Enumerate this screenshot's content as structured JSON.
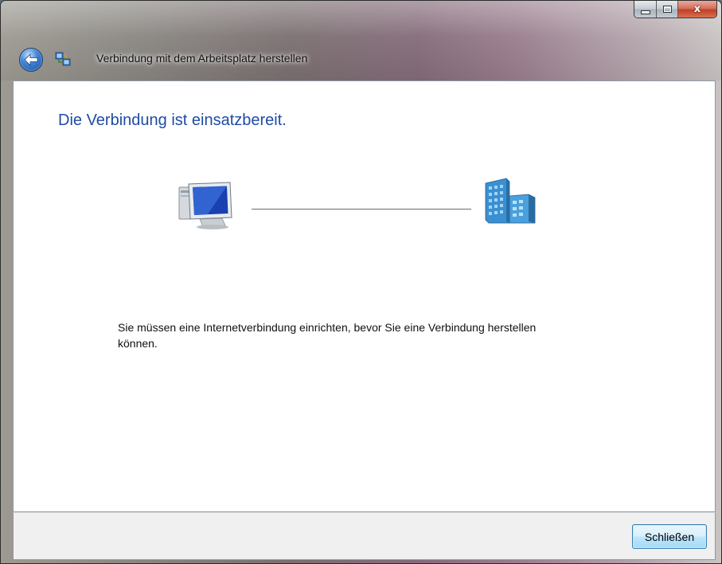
{
  "window": {
    "title": "Verbindung mit dem Arbeitsplatz herstellen",
    "caption_buttons": {
      "close_label": "x"
    }
  },
  "main": {
    "heading": "Die Verbindung ist einsatzbereit.",
    "message": "Sie müssen eine Internetverbindung einrichten, bevor Sie eine Verbindung herstellen können."
  },
  "footer": {
    "close_button_label": "Schließen"
  },
  "colors": {
    "heading": "#1f4ba5",
    "button_border": "#3c7fb1"
  },
  "icons": {
    "back": "back-arrow-icon",
    "app": "network-connection-icon",
    "local": "computer-icon",
    "remote": "workplace-building-icon"
  }
}
